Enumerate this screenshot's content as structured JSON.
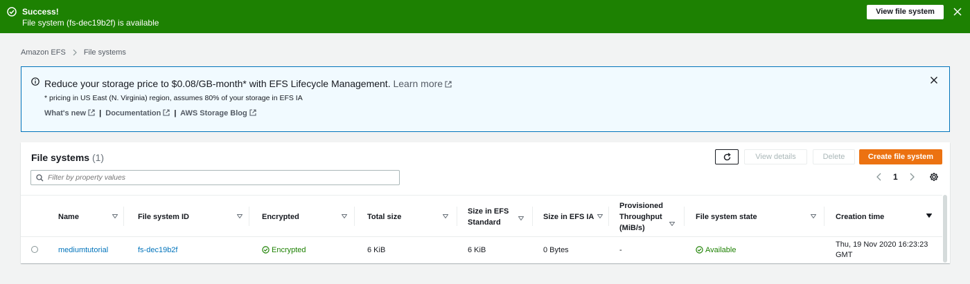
{
  "flash": {
    "title": "Success!",
    "message": "File system (fs-dec19b2f) is available",
    "button_label": "View file system",
    "icons": {
      "status": "check-circle-icon",
      "close": "close-icon"
    }
  },
  "breadcrumb": {
    "items": [
      "Amazon EFS",
      "File systems"
    ]
  },
  "info_banner": {
    "headline": "Reduce your storage price to $0.08/GB-month* with EFS Lifecycle Management.",
    "learn_more": "Learn more",
    "note": "* pricing in US East (N. Virginia) region, assumes 80% of your storage in EFS IA",
    "links": [
      "What's new",
      "Documentation",
      "AWS Storage Blog"
    ],
    "separator": "|"
  },
  "panel": {
    "title": "File systems",
    "count": "(1)",
    "buttons": {
      "view_details": "View details",
      "delete": "Delete",
      "create": "Create file system"
    },
    "filter_placeholder": "Filter by property values",
    "page": "1"
  },
  "table": {
    "columns": [
      "Name",
      "File system ID",
      "Encrypted",
      "Total size",
      "Size in EFS Standard",
      "Size in EFS IA",
      "Provisioned Throughput (MiB/s)",
      "File system state",
      "Creation time"
    ],
    "rows": [
      {
        "name": "mediumtutorial",
        "id": "fs-dec19b2f",
        "encrypted": "Encrypted",
        "total_size": "6 KiB",
        "size_standard": "6 KiB",
        "size_ia": "0 Bytes",
        "throughput": "-",
        "state": "Available",
        "creation_time": "Thu, 19 Nov 2020 16:23:23 GMT"
      }
    ]
  },
  "colors": {
    "success": "#1d8102",
    "link": "#0073bb",
    "primary_button": "#ec7211",
    "info_border": "#0073bb",
    "info_background": "#f1faff"
  }
}
